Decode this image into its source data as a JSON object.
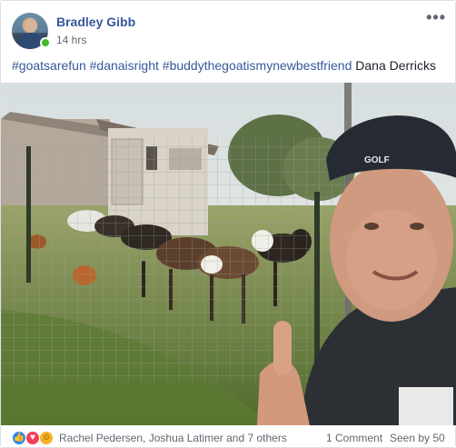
{
  "post": {
    "author": "Bradley Gibb",
    "timestamp": "14 hrs",
    "more_label": "•••",
    "text_hashtags": "#goatsarefun #danaisright #buddythegoatismynewbestfriend",
    "text_tag": "Dana Derricks"
  },
  "photo": {
    "cap_text": "GOLF"
  },
  "footer": {
    "reactors": "Rachel Pedersen, Joshua Latimer and 7 others",
    "comments": "1 Comment",
    "seen": "Seen by 50",
    "reactions": [
      "like-icon",
      "love-icon",
      "haha-icon"
    ]
  },
  "colors": {
    "link": "#365899",
    "online": "#42b72a",
    "like": "#2d88ff",
    "love": "#f33e58",
    "haha": "#f7b125"
  }
}
